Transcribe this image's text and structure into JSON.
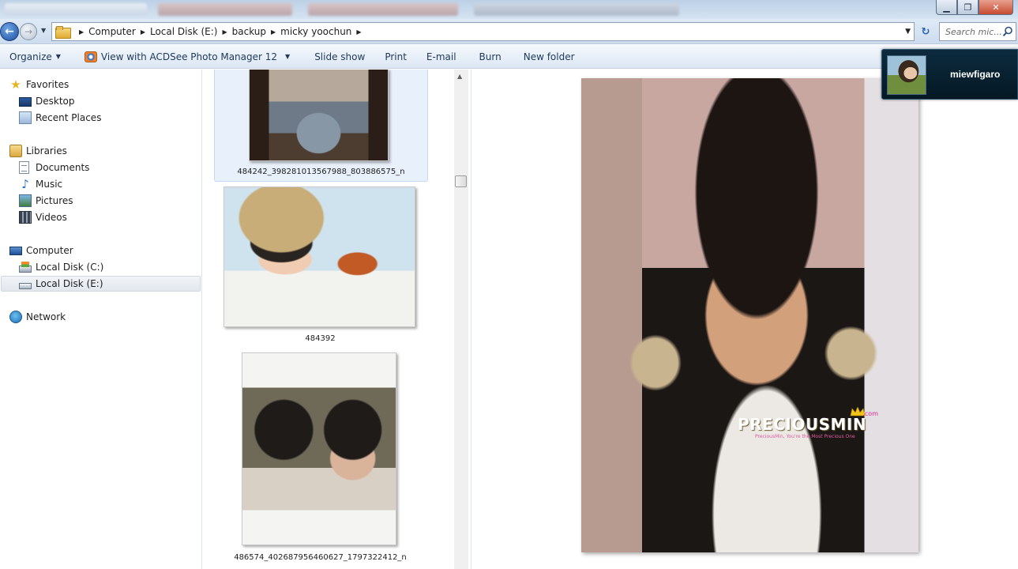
{
  "window": {
    "minimize_glyph": "▁",
    "maximize_glyph": "❐",
    "close_glyph": "✕"
  },
  "address": {
    "breadcrumbs": [
      "Computer",
      "Local Disk (E:)",
      "backup",
      "micky yoochun"
    ],
    "search_placeholder": "Search mic..."
  },
  "toolbar": {
    "organize": "Organize",
    "acdsee": "View with ACDSee Photo Manager 12",
    "slideshow": "Slide show",
    "print": "Print",
    "email": "E-mail",
    "burn": "Burn",
    "new_folder": "New folder"
  },
  "nav": {
    "favorites": "Favorites",
    "desktop": "Desktop",
    "recent_places": "Recent Places",
    "libraries": "Libraries",
    "documents": "Documents",
    "music": "Music",
    "pictures": "Pictures",
    "videos": "Videos",
    "computer": "Computer",
    "local_disk_c": "Local Disk (C:)",
    "local_disk_e": "Local Disk (E:)",
    "network": "Network"
  },
  "files": [
    {
      "name": "484242_398281013567988_803886575_n",
      "selected": true
    },
    {
      "name": "484392",
      "selected": false
    },
    {
      "name": "486574_402687956460627_1797322412_n",
      "selected": false
    }
  ],
  "preview": {
    "watermark_main": "PRECIOUSMIN",
    "watermark_domain": ".com",
    "watermark_tagline": "PreciousMin, You're the Most Precious One"
  },
  "user_badge": {
    "username": "miewfigaro"
  },
  "colors": {
    "accent": "#1e395b",
    "selection": "#e8f0fb",
    "badge_bg": "#0c2b3e"
  }
}
